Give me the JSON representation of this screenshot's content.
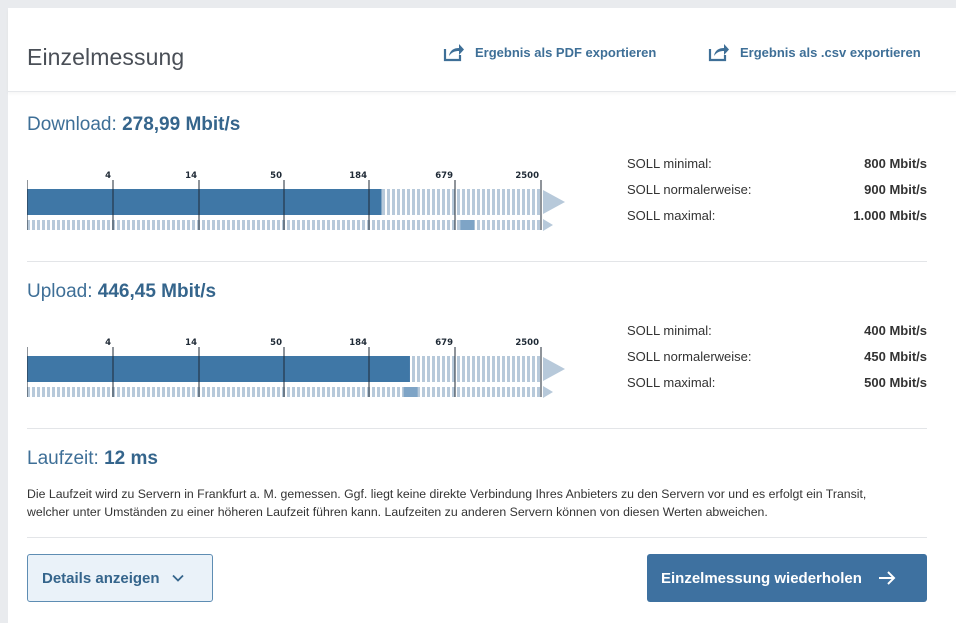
{
  "header": {
    "title": "Einzelmessung",
    "export_pdf": "Ergebnis als PDF exportieren",
    "export_csv": "Ergebnis als .csv exportieren"
  },
  "scale_ticks": [
    "4",
    "14",
    "50",
    "184",
    "679",
    "2500"
  ],
  "download": {
    "label": "Download:",
    "value": "278,99 Mbit/s",
    "bar_fraction": 0.69,
    "lower_marker_fraction": 0.87,
    "soll": [
      {
        "label": "SOLL minimal:",
        "value": "800 Mbit/s"
      },
      {
        "label": "SOLL normalerweise:",
        "value": "900 Mbit/s"
      },
      {
        "label": "SOLL maximal:",
        "value": "1.000 Mbit/s"
      }
    ]
  },
  "upload": {
    "label": "Upload:",
    "value": "446,45 Mbit/s",
    "bar_fraction": 0.745,
    "lower_marker_fraction": 0.76,
    "soll": [
      {
        "label": "SOLL minimal:",
        "value": "400 Mbit/s"
      },
      {
        "label": "SOLL normalerweise:",
        "value": "450 Mbit/s"
      },
      {
        "label": "SOLL maximal:",
        "value": "500 Mbit/s"
      }
    ]
  },
  "latency": {
    "label": "Laufzeit:",
    "value": "12 ms"
  },
  "description": "Die Laufzeit wird zu Servern in Frankfurt a. M. gemessen. Ggf. liegt keine direkte Verbindung Ihres Anbieters zu den Servern vor und es erfolgt ein Transit, welcher unter Umständen zu einer höheren Laufzeit führen kann. Laufzeiten zu anderen Servern können von diesen Werten abweichen.",
  "buttons": {
    "details": "Details anzeigen",
    "repeat": "Einzelmessung wiederholen"
  },
  "colors": {
    "accent": "#3e71a0",
    "bar_fill": "#3f77a6",
    "bar_track": "#b7c9da",
    "text_blue": "#35658c"
  }
}
